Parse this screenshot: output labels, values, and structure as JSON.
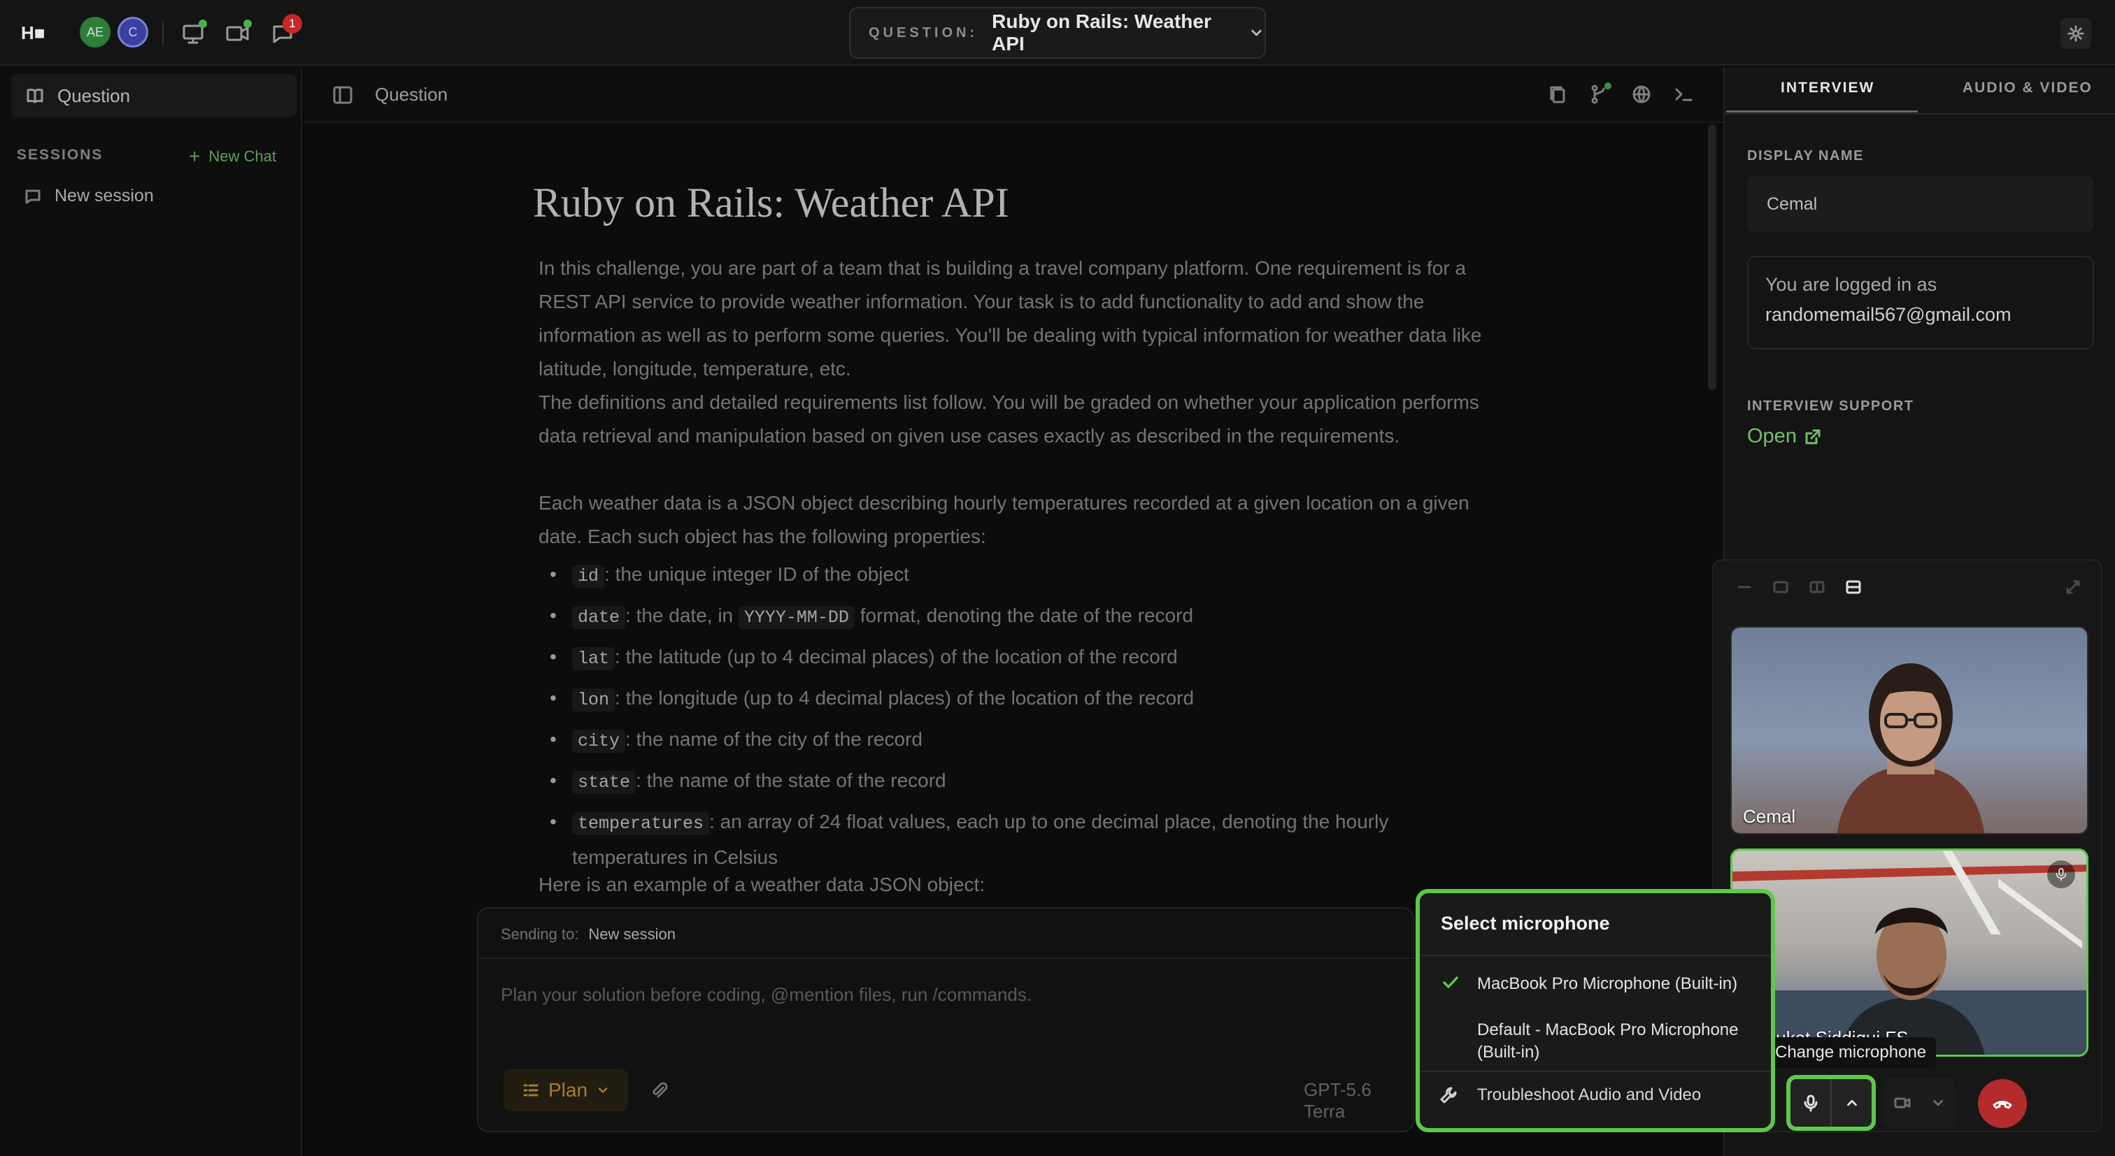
{
  "app": {
    "logo": "H■",
    "avatars": [
      {
        "initials": "AE",
        "color": "#2e7d3a"
      },
      {
        "initials": "C",
        "color": "#3b3f9e"
      }
    ],
    "notification_count": "1"
  },
  "question_select": {
    "label": "QUESTION:",
    "value": "Ruby on Rails: Weather API"
  },
  "sidebar": {
    "question_label": "Question",
    "sessions_label": "SESSIONS",
    "new_chat_label": "New Chat",
    "session_items": [
      "New session"
    ]
  },
  "main": {
    "header_title": "Question",
    "doc": {
      "title": "Ruby on Rails: Weather API",
      "p1": "In this challenge, you are part of a team that is building a travel company platform. One requirement is for a REST API service to provide weather information. Your task is to add functionality to add and show the information as well as to perform some queries. You'll be dealing with typical information for weather data like latitude, longitude, temperature, etc.",
      "p2": "The definitions and detailed requirements list follow. You will be graded on whether your application performs data retrieval and manipulation based on given use cases exactly as described in the requirements.",
      "p3": "Each weather data is a JSON object describing hourly temperatures recorded at a given location on a given date. Each such object has the following properties:",
      "bullets": [
        {
          "code": "id",
          "text": ": the unique integer ID of the object"
        },
        {
          "code": "date",
          "text": ": the date, in ",
          "code2": "YYYY-MM-DD",
          "text2": " format, denoting the date of the record"
        },
        {
          "code": "lat",
          "text": ": the latitude (up to 4 decimal places) of the location of the record"
        },
        {
          "code": "lon",
          "text": ": the longitude (up to 4 decimal places) of the location of the record"
        },
        {
          "code": "city",
          "text": ": the name of the city of the record"
        },
        {
          "code": "state",
          "text": ": the name of the state of the record"
        },
        {
          "code": "temperatures",
          "text": ": an array of 24 float values, each up to one decimal place, denoting the hourly temperatures in Celsius"
        }
      ],
      "p4": "Here is an example of a weather data JSON object:"
    }
  },
  "composer": {
    "sending_to_label": "Sending to:",
    "sending_to_value": "New session",
    "placeholder": "Plan your solution before coding, @mention files, run /commands.",
    "plan_label": "Plan",
    "model_label": "GPT-5.6 Terra"
  },
  "right_panel": {
    "tabs": [
      "INTERVIEW",
      "AUDIO & VIDEO"
    ],
    "display_name_label": "DISPLAY NAME",
    "display_name_value": "Cemal",
    "logged_in_line1": "You are logged in as",
    "logged_in_email": "randomemail567@gmail.com",
    "support_label": "INTERVIEW SUPPORT",
    "support_link": "Open"
  },
  "video": {
    "tiles": [
      {
        "name": "Cemal"
      },
      {
        "name": "Shaukat Siddiqui FS"
      }
    ],
    "tooltip": "Change microphone"
  },
  "mic_popup": {
    "title": "Select microphone",
    "options": [
      {
        "label": "MacBook Pro Microphone (Built-in)",
        "selected": true
      },
      {
        "label": "Default - MacBook Pro Microphone (Built-in)",
        "selected": false
      }
    ],
    "troubleshoot_label": "Troubleshoot Audio and Video"
  },
  "colors": {
    "accent_green": "#5cc949",
    "link_green": "#6fc16a",
    "plan_amber": "#c99a3d",
    "hangup_red": "#b32b2b"
  }
}
